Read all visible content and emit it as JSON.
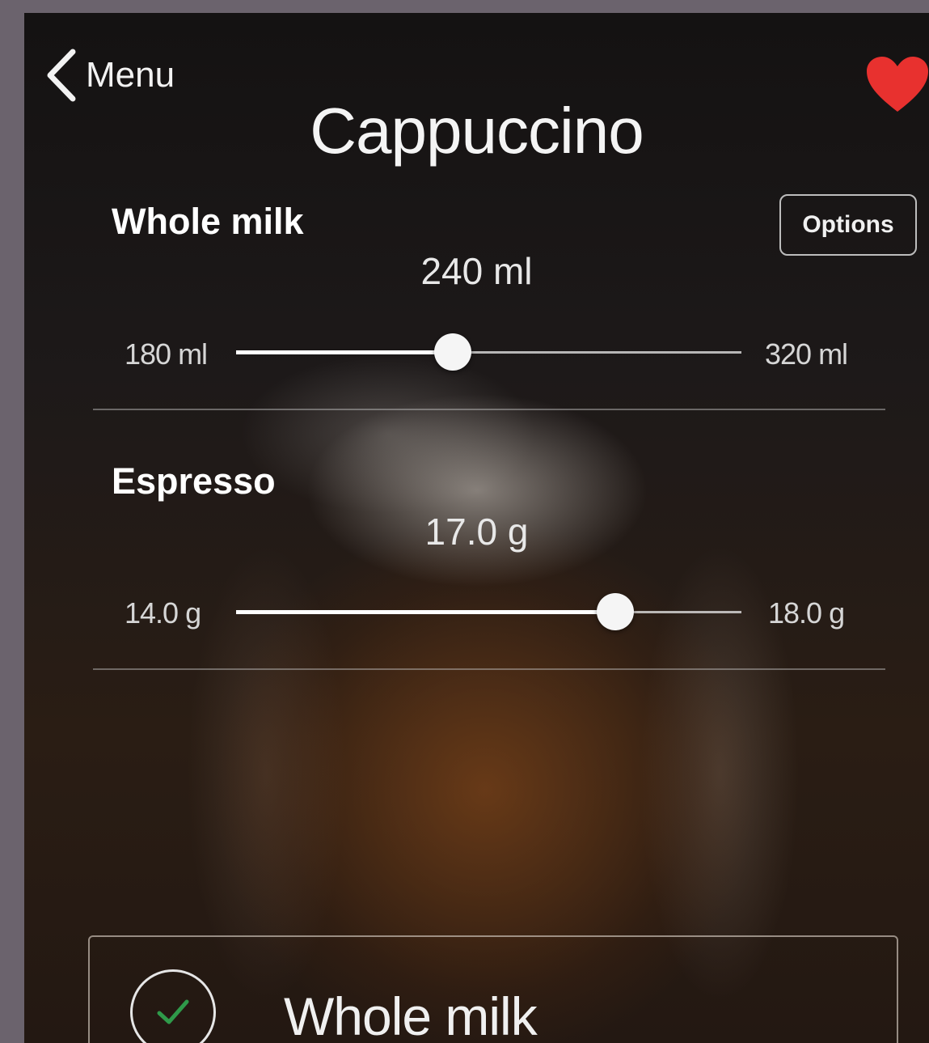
{
  "nav": {
    "back_label": "Menu",
    "title": "Cappuccino",
    "favorite_color": "#e8312f"
  },
  "milk": {
    "label": "Whole milk",
    "options_label": "Options",
    "value": "240 ml",
    "min_label": "180 ml",
    "max_label": "320 ml",
    "min": 180,
    "max": 320,
    "current": 240
  },
  "espresso": {
    "label": "Espresso",
    "value": "17.0 g",
    "min_label": "14.0 g",
    "max_label": "18.0 g",
    "min": 14.0,
    "max": 18.0,
    "current": 17.0
  },
  "milk_choice": {
    "label": "Whole milk",
    "selected": true,
    "check_color": "#2f9a4a"
  }
}
